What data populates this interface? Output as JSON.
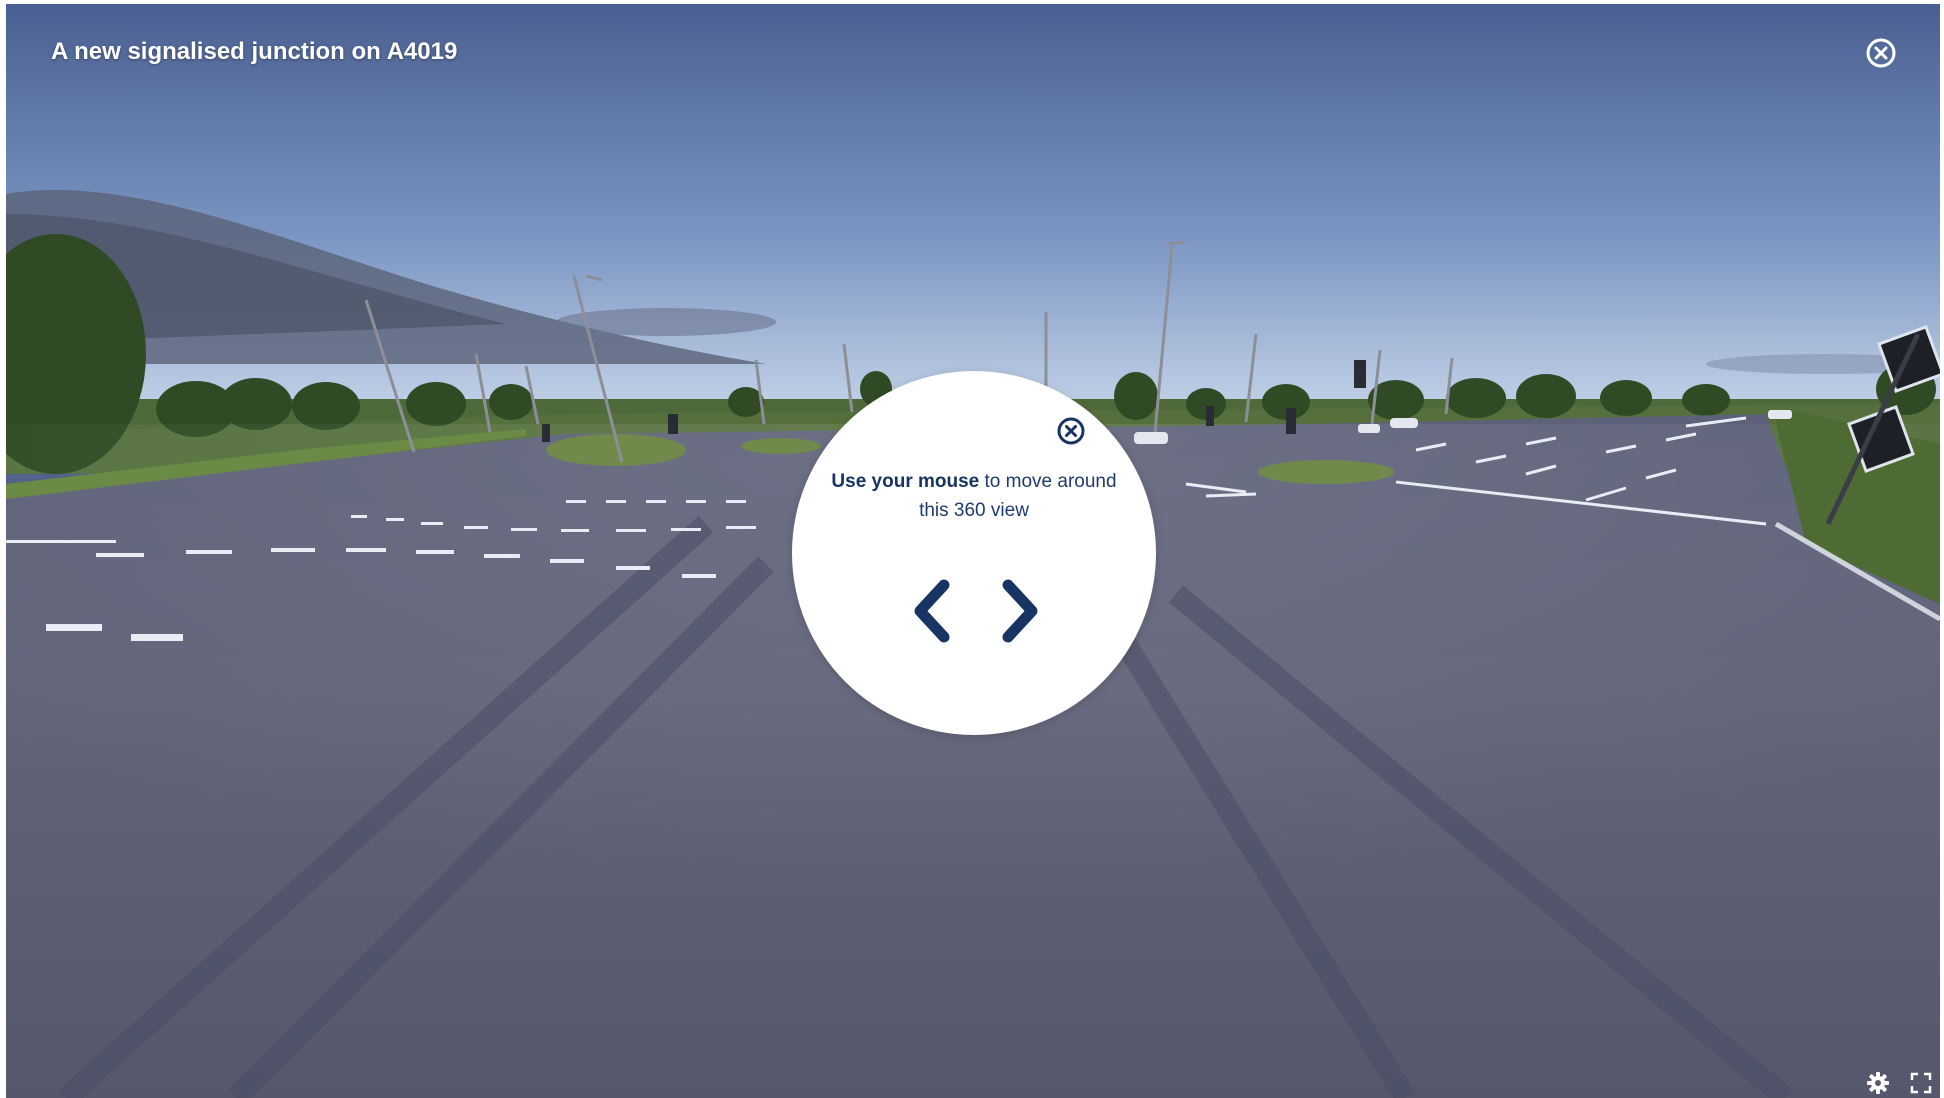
{
  "viewer": {
    "title": "A new signalised junction on A4019"
  },
  "hint": {
    "bold_text": "Use your mouse",
    "text_rest": " to move around this 360 view"
  },
  "icons": {
    "close": "close-circle-icon",
    "hint_close": "close-circle-icon",
    "prev": "chevron-left-icon",
    "next": "chevron-right-icon",
    "settings": "gear-icon",
    "fullscreen": "fullscreen-icon"
  },
  "colors": {
    "accent": "#173463",
    "hint_background": "#ffffff",
    "title_text": "#ffffff"
  }
}
